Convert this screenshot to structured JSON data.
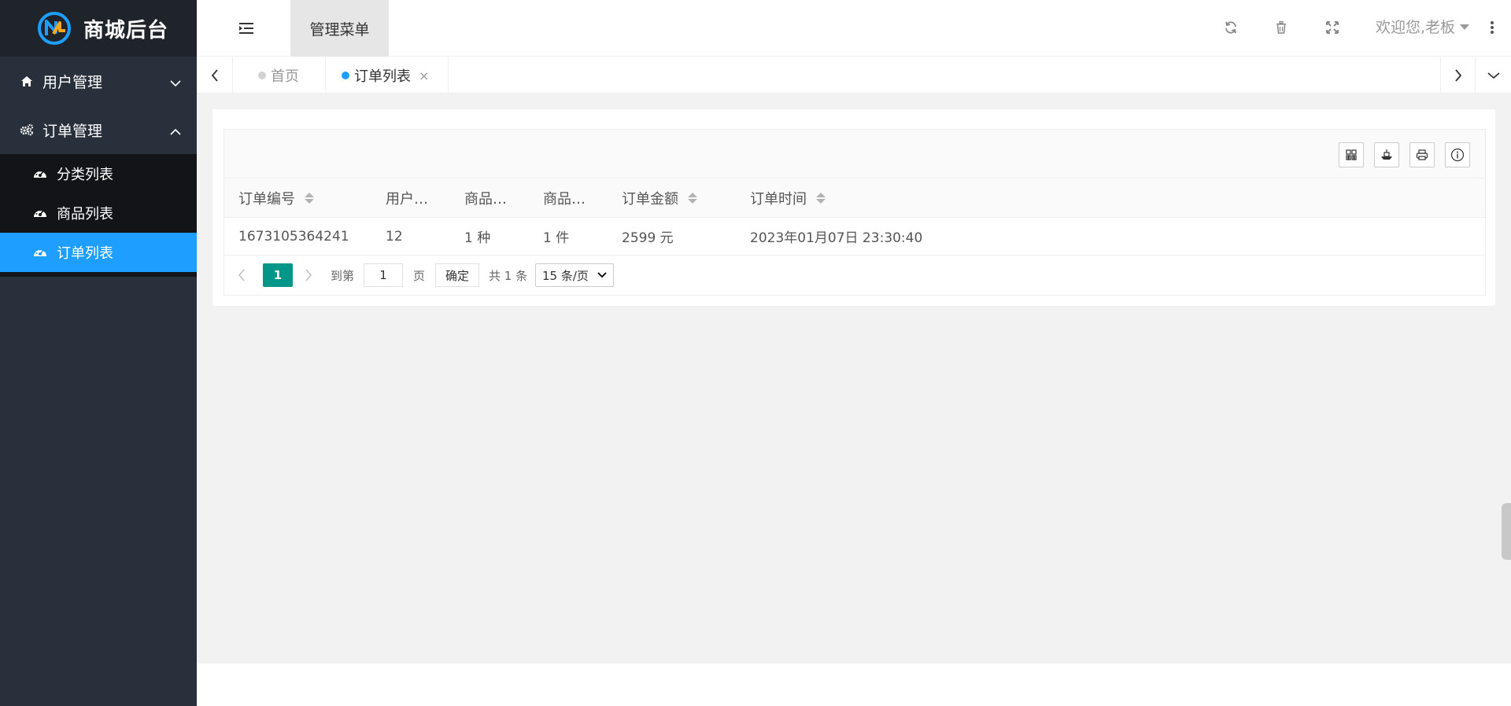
{
  "brand": {
    "title": "商城后台"
  },
  "sidebar": {
    "groups": [
      {
        "label": "用户管理",
        "icon": "home-icon",
        "expanded": false
      },
      {
        "label": "订单管理",
        "icon": "gears-icon",
        "expanded": true
      }
    ],
    "subitems": [
      {
        "label": "分类列表",
        "icon": "dashboard-icon",
        "active": false
      },
      {
        "label": "商品列表",
        "icon": "dashboard-icon",
        "active": false
      },
      {
        "label": "订单列表",
        "icon": "dashboard-icon",
        "active": true
      }
    ]
  },
  "header": {
    "menu_tab": "管理菜单",
    "welcome": "欢迎您,老板",
    "icons": [
      "refresh-icon",
      "trash-icon",
      "fullscreen-icon",
      "more-icon"
    ]
  },
  "tabs": {
    "items": [
      {
        "label": "首页",
        "active": false
      },
      {
        "label": "订单列表",
        "active": true,
        "close": "×"
      }
    ]
  },
  "table": {
    "toolbar_icons": [
      "columns-icon",
      "export-icon",
      "print-icon",
      "info-icon"
    ],
    "columns": [
      "订单编号",
      "用户…",
      "商品…",
      "商品…",
      "订单金额",
      "订单时间"
    ],
    "rows": [
      [
        "1673105364241",
        "12",
        "1 种",
        "1 件",
        "2599 元",
        "2023年01月07日 23:30:40"
      ]
    ]
  },
  "pagination": {
    "current": "1",
    "goto_label": "到第",
    "goto_value": "1",
    "page_label": "页",
    "confirm": "确定",
    "total": "共 1 条",
    "page_size": "15 条/页"
  },
  "colors": {
    "sidebar_bg": "#28303b",
    "active_blue": "#1e9fff",
    "pager_active": "#009688"
  }
}
